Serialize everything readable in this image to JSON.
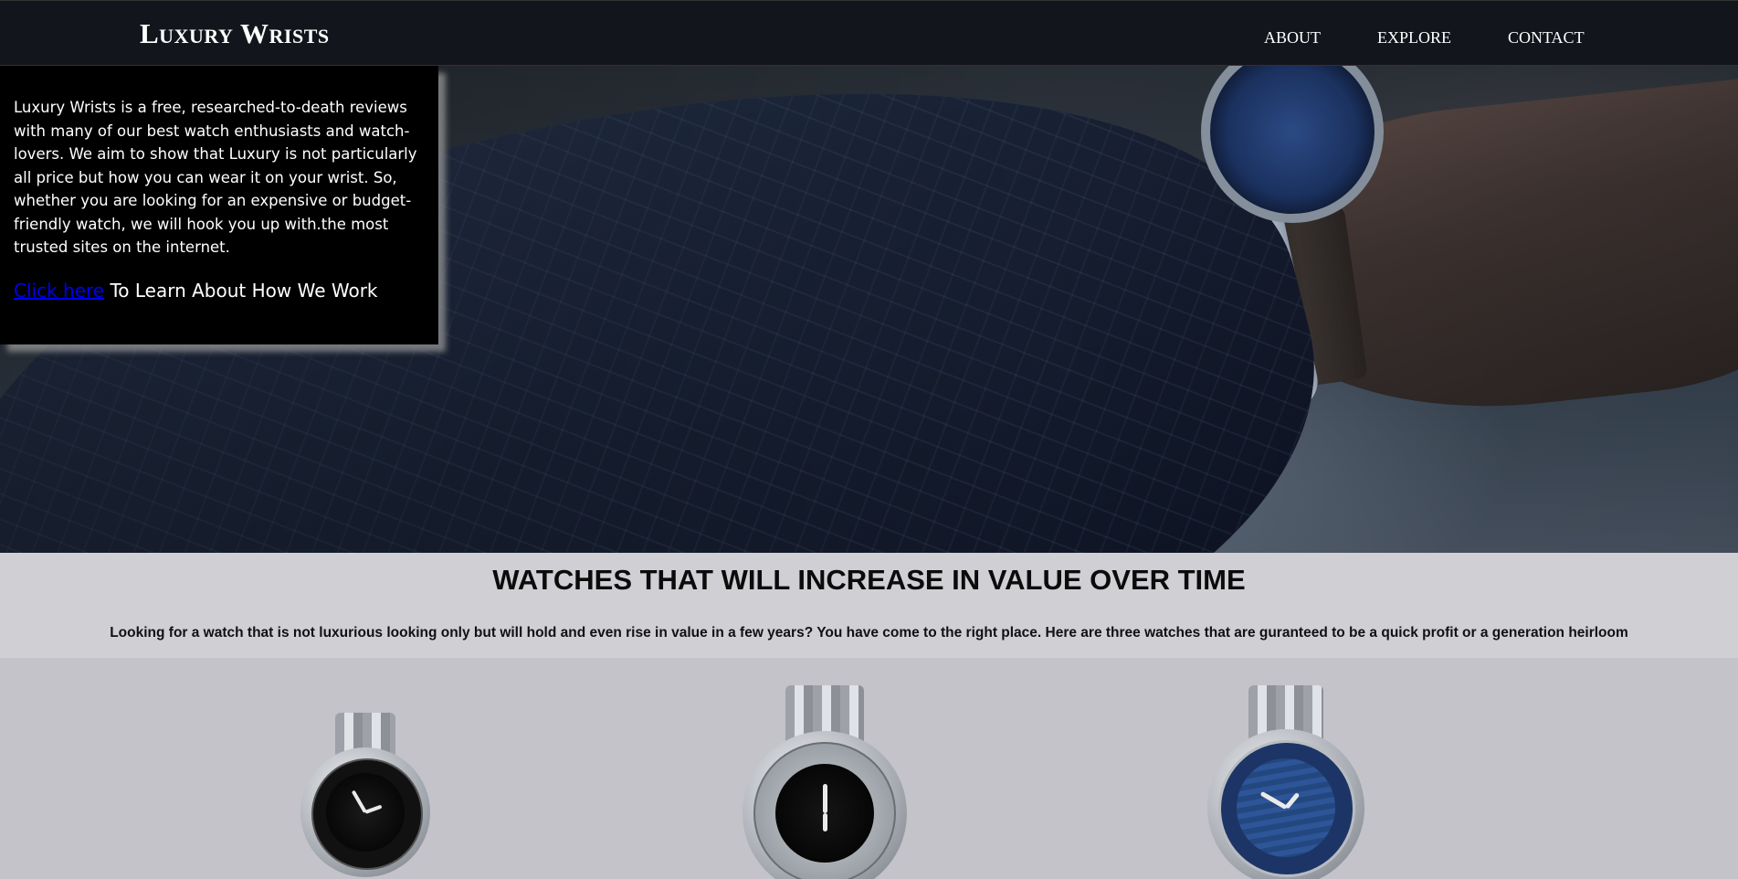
{
  "nav": {
    "brand": "Luxury Wrists",
    "links": [
      "ABOUT",
      "EXPLORE",
      "CONTACT"
    ]
  },
  "hero": {
    "description": "Luxury Wrists is a free, researched-to-death reviews with many of our best watch enthusiasts and watch-lovers. We aim to show that Luxury is not particularly all price but how you can wear it on your wrist. So, whether you are looking for an expensive or budget-friendly watch, we will hook you up with.the most trusted sites on the internet.",
    "cta_link": "Click here",
    "cta_text": " To Learn About How We Work"
  },
  "intro": {
    "title": "WATCHES THAT WILL INCREASE IN VALUE OVER TIME",
    "text": "Looking for a watch that is not luxurious looking only but will hold and even rise in value in a few years? You have come to the right place. Here are three watches that are guranteed to be a quick profit or a generation heirloom"
  },
  "colors": {
    "nav_bg": "#12151c",
    "info_bg": "#000000",
    "link": "#0000ee",
    "intro_bg": "#d0cfd4",
    "products_bg": "#c3c3c9"
  },
  "products": [
    {
      "image": "rolex-submariner-black-watch-image"
    },
    {
      "image": "tudor-black-bay-watch-image"
    },
    {
      "image": "omega-seamaster-blue-watch-image"
    }
  ]
}
